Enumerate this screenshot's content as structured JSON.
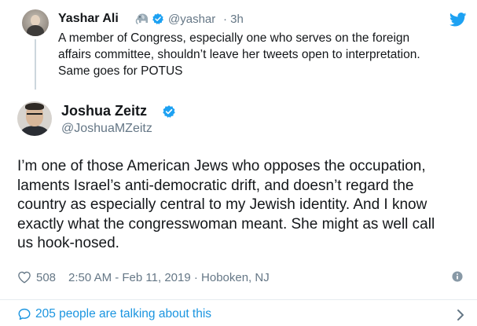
{
  "quoted_tweet": {
    "name": "Yashar Ali",
    "emoji_icon": "elephant-icon",
    "handle": "@yashar",
    "separator": "·",
    "time": "3h",
    "text_lines": [
      "A member of Congress, especially one who serves on the foreign",
      "affairs committee, shouldn’t leave her tweets open to interpretation.",
      "Same goes for POTUS"
    ]
  },
  "main_tweet": {
    "name": "Joshua Zeitz",
    "handle": "@JoshuaMZeitz",
    "text_lines": [
      "I’m one of those American Jews who opposes the occupation,",
      "laments Israel’s anti-democratic drift, and doesn’t regard the",
      "country as especially central to my Jewish identity. And I know",
      "exactly what the congresswoman meant. She might as well call",
      "us hook-nosed."
    ],
    "likes": "508",
    "timestamp": "2:50 AM - Feb 11, 2019 · Hoboken, NJ"
  },
  "footer": {
    "talking_text": "205 people are talking about this"
  },
  "colors": {
    "twitter_blue": "#1da1f2",
    "link_blue": "#1b95e0",
    "muted_gray": "#657786",
    "text_dark": "#14171a"
  }
}
